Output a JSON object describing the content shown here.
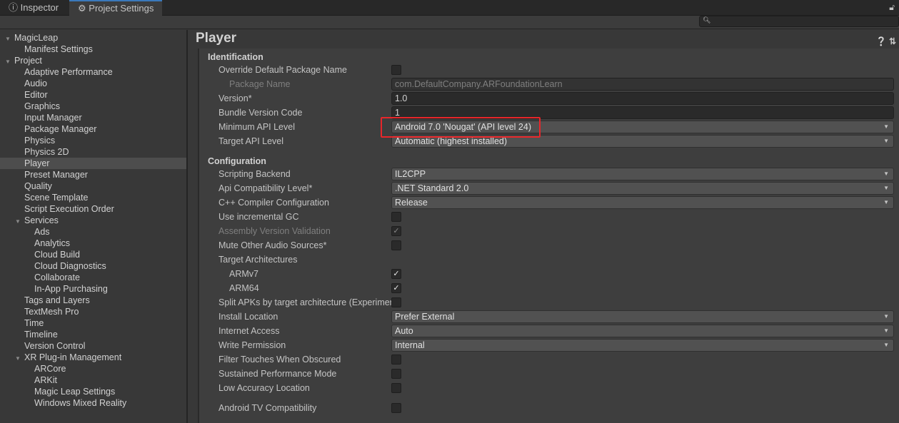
{
  "tabs": [
    {
      "label": "Inspector",
      "icon": "info-icon"
    },
    {
      "label": "Project Settings",
      "icon": "gear-icon",
      "active": true
    }
  ],
  "search": {
    "placeholder": "",
    "value": ""
  },
  "sidebar": [
    {
      "label": "MagicLeap",
      "level": 0,
      "expanded": true
    },
    {
      "label": "Manifest Settings",
      "level": 1
    },
    {
      "label": "Project",
      "level": 0,
      "expanded": true
    },
    {
      "label": "Adaptive Performance",
      "level": 1
    },
    {
      "label": "Audio",
      "level": 1
    },
    {
      "label": "Editor",
      "level": 1
    },
    {
      "label": "Graphics",
      "level": 1
    },
    {
      "label": "Input Manager",
      "level": 1
    },
    {
      "label": "Package Manager",
      "level": 1
    },
    {
      "label": "Physics",
      "level": 1
    },
    {
      "label": "Physics 2D",
      "level": 1
    },
    {
      "label": "Player",
      "level": 1,
      "selected": true
    },
    {
      "label": "Preset Manager",
      "level": 1
    },
    {
      "label": "Quality",
      "level": 1
    },
    {
      "label": "Scene Template",
      "level": 1
    },
    {
      "label": "Script Execution Order",
      "level": 1
    },
    {
      "label": "Services",
      "level": 1,
      "expanded": true
    },
    {
      "label": "Ads",
      "level": 2
    },
    {
      "label": "Analytics",
      "level": 2
    },
    {
      "label": "Cloud Build",
      "level": 2
    },
    {
      "label": "Cloud Diagnostics",
      "level": 2
    },
    {
      "label": "Collaborate",
      "level": 2
    },
    {
      "label": "In-App Purchasing",
      "level": 2
    },
    {
      "label": "Tags and Layers",
      "level": 1
    },
    {
      "label": "TextMesh Pro",
      "level": 1
    },
    {
      "label": "Time",
      "level": 1
    },
    {
      "label": "Timeline",
      "level": 1
    },
    {
      "label": "Version Control",
      "level": 1
    },
    {
      "label": "XR Plug-in Management",
      "level": 1,
      "expanded": true
    },
    {
      "label": "ARCore",
      "level": 2
    },
    {
      "label": "ARKit",
      "level": 2
    },
    {
      "label": "Magic Leap Settings",
      "level": 2
    },
    {
      "label": "Windows Mixed Reality",
      "level": 2
    }
  ],
  "header": {
    "title": "Player"
  },
  "rows": [
    {
      "type": "section",
      "label": "Identification"
    },
    {
      "type": "check",
      "label": "Override Default Package Name",
      "checked": false
    },
    {
      "type": "text",
      "label": "Package Name",
      "value": "com.DefaultCompany.ARFoundationLearn",
      "disabled": true,
      "indent": 1
    },
    {
      "type": "text",
      "label": "Version*",
      "value": "1.0"
    },
    {
      "type": "text",
      "label": "Bundle Version Code",
      "value": "1"
    },
    {
      "type": "dropdown",
      "label": "Minimum API Level",
      "value": "Android 7.0 'Nougat' (API level 24)",
      "highlighted": true
    },
    {
      "type": "dropdown",
      "label": "Target API Level",
      "value": "Automatic (highest installed)"
    },
    {
      "type": "section",
      "label": "Configuration"
    },
    {
      "type": "dropdown",
      "label": "Scripting Backend",
      "value": "IL2CPP"
    },
    {
      "type": "dropdown",
      "label": "Api Compatibility Level*",
      "value": ".NET Standard 2.0"
    },
    {
      "type": "dropdown",
      "label": "C++ Compiler Configuration",
      "value": "Release"
    },
    {
      "type": "check",
      "label": "Use incremental GC",
      "checked": false
    },
    {
      "type": "check",
      "label": "Assembly Version Validation",
      "checked": true,
      "disabled": true
    },
    {
      "type": "check",
      "label": "Mute Other Audio Sources*",
      "checked": false
    },
    {
      "type": "label",
      "label": "Target Architectures"
    },
    {
      "type": "check",
      "label": "ARMv7",
      "checked": true,
      "indent": 1
    },
    {
      "type": "check",
      "label": "ARM64",
      "checked": true,
      "indent": 1
    },
    {
      "type": "check",
      "label": "Split APKs by target architecture (Experimental)",
      "checked": false
    },
    {
      "type": "dropdown",
      "label": "Install Location",
      "value": "Prefer External"
    },
    {
      "type": "dropdown",
      "label": "Internet Access",
      "value": "Auto"
    },
    {
      "type": "dropdown",
      "label": "Write Permission",
      "value": "Internal"
    },
    {
      "type": "check",
      "label": "Filter Touches When Obscured",
      "checked": false
    },
    {
      "type": "check",
      "label": "Sustained Performance Mode",
      "checked": false
    },
    {
      "type": "check",
      "label": "Low Accuracy Location",
      "checked": false
    },
    {
      "type": "spacer"
    },
    {
      "type": "check",
      "label": "Android TV Compatibility",
      "checked": false
    }
  ],
  "colors": {
    "accent": "#3a79bb",
    "highlight": "#e8262a"
  }
}
